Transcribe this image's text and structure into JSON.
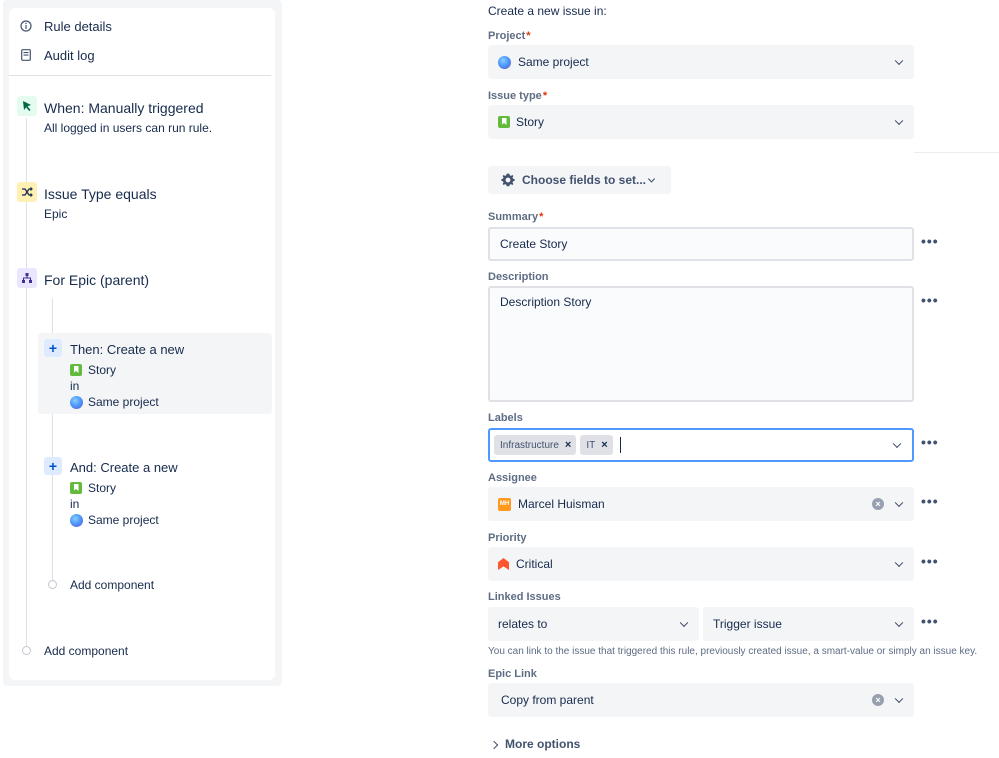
{
  "sidebar": {
    "links": [
      {
        "label": "Rule details",
        "icon": "info-icon"
      },
      {
        "label": "Audit log",
        "icon": "document-icon"
      }
    ],
    "trigger": {
      "title": "When: Manually triggered",
      "subtitle": "All logged in users can run rule.",
      "icon": "cursor-click-icon",
      "color": "#36b37e"
    },
    "condition": {
      "title": "Issue Type equals",
      "subtitle": "Epic",
      "icon": "shuffle-icon",
      "color": "#ffc400"
    },
    "branch": {
      "title": "For Epic (parent)",
      "icon": "hierarchy-icon",
      "color": "#6554c0"
    },
    "action1": {
      "title": "Then: Create a new",
      "issue_type": "Story",
      "connector": "in",
      "project": "Same project"
    },
    "action2": {
      "title": "And: Create a new",
      "issue_type": "Story",
      "connector": "in",
      "project": "Same project"
    },
    "add_component_inner": "Add component",
    "add_component_outer": "Add component"
  },
  "form": {
    "heading": "Create a new issue in:",
    "project": {
      "label": "Project",
      "required": "*",
      "value": "Same project"
    },
    "issue_type": {
      "label": "Issue type",
      "required": "*",
      "value": "Story"
    },
    "choose_fields": "Choose fields to set...",
    "summary": {
      "label": "Summary",
      "required": "*",
      "value": "Create Story"
    },
    "description": {
      "label": "Description",
      "value": "Description Story"
    },
    "labels": {
      "label": "Labels",
      "tags": [
        "Infrastructure",
        "IT"
      ]
    },
    "assignee": {
      "label": "Assignee",
      "initials": "MH",
      "value": "Marcel Huisman"
    },
    "priority": {
      "label": "Priority",
      "value": "Critical",
      "color": "#ff5630"
    },
    "linked_issues": {
      "label": "Linked Issues",
      "relation": "relates to",
      "target": "Trigger issue"
    },
    "help_text": "You can link to the issue that triggered this rule, previously created issue, a smart-value or simply an issue key.",
    "epic_link": {
      "label": "Epic Link",
      "value": "Copy from parent"
    },
    "more_options": "More options",
    "dots": "•••",
    "clear": "×",
    "tag_remove": "×"
  }
}
